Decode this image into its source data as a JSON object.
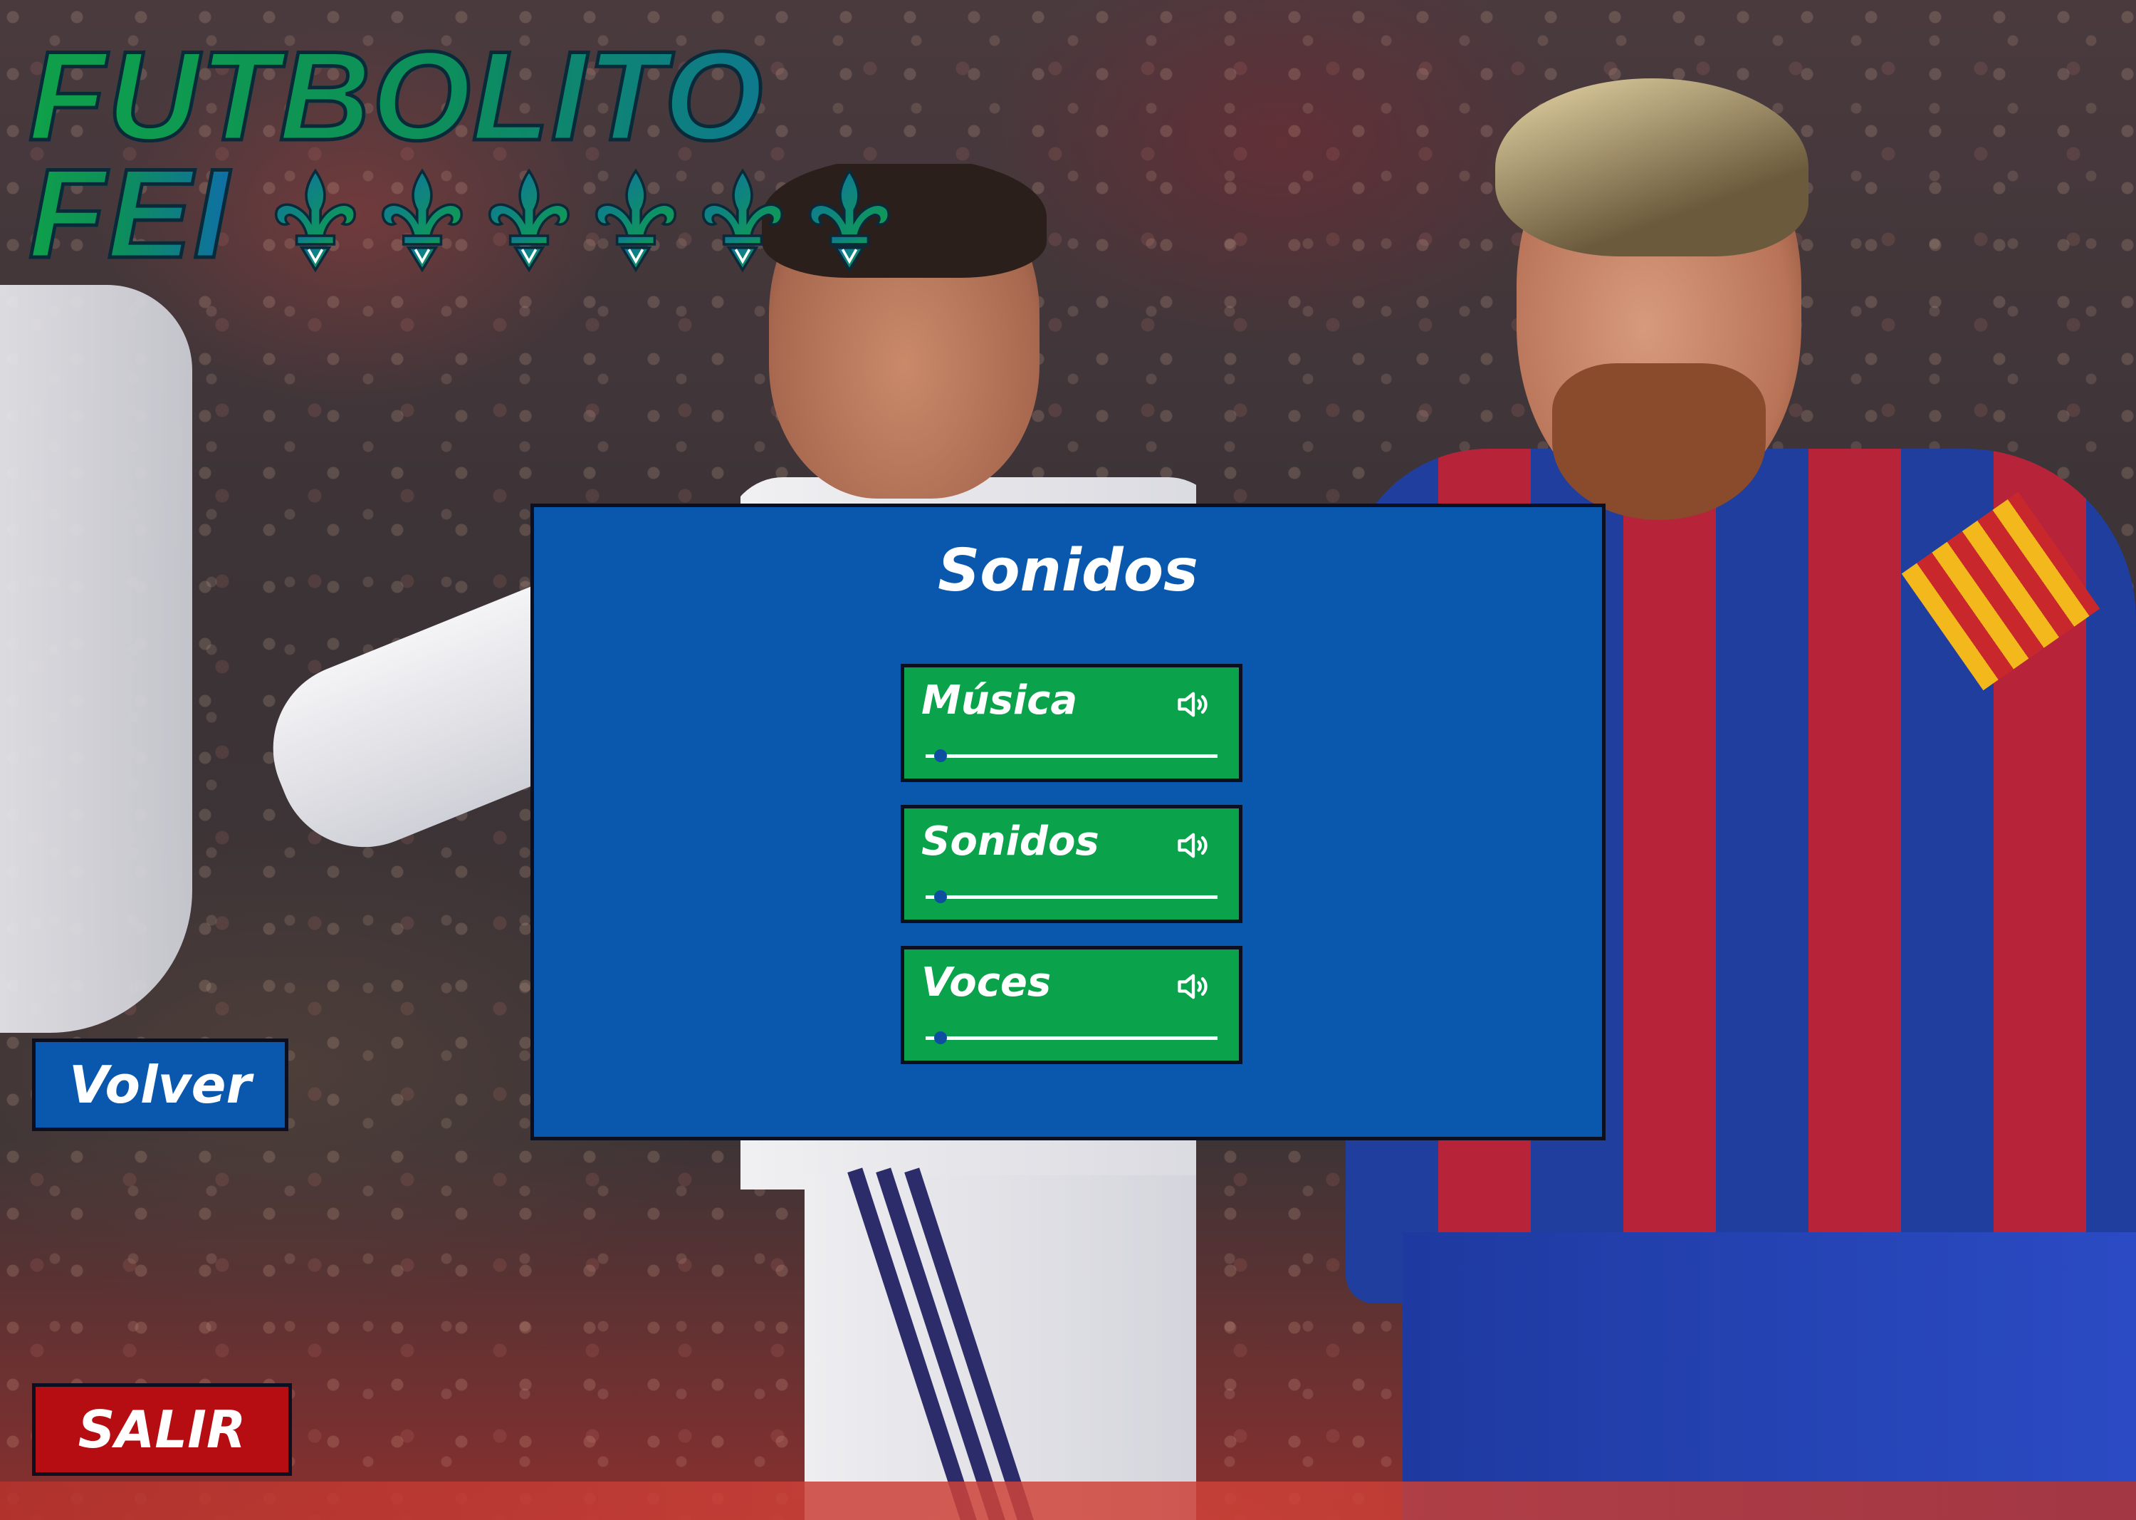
{
  "game": {
    "logo_line1": "FUTBOLITO",
    "logo_line2": "FEI",
    "fleur_count": 6
  },
  "settings": {
    "title": "Sonidos",
    "channels": [
      {
        "label": "Música",
        "icon": "speaker-icon",
        "level": 0.05
      },
      {
        "label": "Sonidos",
        "icon": "speaker-icon",
        "level": 0.05
      },
      {
        "label": "Voces",
        "icon": "speaker-icon",
        "level": 0.05
      }
    ]
  },
  "buttons": {
    "back_label": "Volver",
    "exit_label": "SALIR"
  },
  "colors": {
    "panel": "#0a58ad",
    "card": "#0aa24a",
    "exit": "#b50d12",
    "logo_green": "#0fa04a",
    "logo_blue": "#0f6fa6"
  }
}
